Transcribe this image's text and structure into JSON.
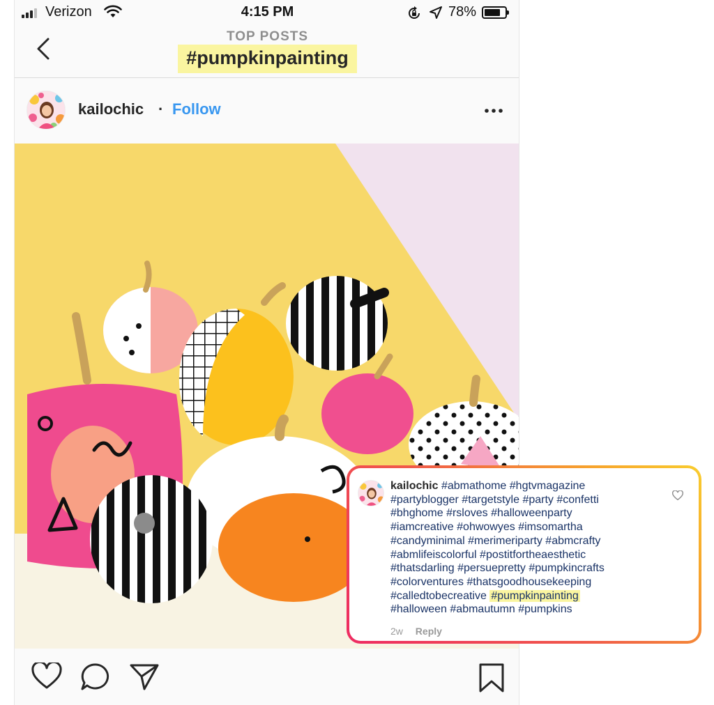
{
  "status_bar": {
    "carrier": "Verizon",
    "time": "4:15 PM",
    "battery_percent": "78%",
    "battery_level": 0.78,
    "icons": [
      "signal-icon",
      "wifi-icon",
      "rotation-lock-icon",
      "location-icon",
      "battery-icon"
    ]
  },
  "header": {
    "kicker": "TOP POSTS",
    "title": "#pumpkinpainting",
    "highlight_color": "#faf5a0",
    "back_icon": "chevron-left-icon"
  },
  "post": {
    "username": "kailochic",
    "separator": "·",
    "follow_label": "Follow",
    "follow_color": "#3897f0",
    "more_icon": "more-horizontal-icon",
    "photo_description_icon": "painted-pumpkins-photo",
    "actions": [
      "heart-icon",
      "comment-icon",
      "share-icon",
      "bookmark-icon"
    ]
  },
  "caption": {
    "username": "kailochic",
    "lines": [
      "#abmathome #hgtvmagazine",
      "#partyblogger #targetstyle #party #confetti",
      "#bhghome #rsloves #halloweenparty",
      "#iamcreative #ohwowyes #imsomartha",
      "#candyminimal #merimeriparty  #abmcrafty",
      "#abmlifeiscolorful #postitfortheaesthetic",
      "#thatsdarling #persuepretty #pumpkincrafts",
      "#colorventures #thatsgoodhousekeeping",
      "#calledtobecreative",
      "#halloween #abmautumn #pumpkins"
    ],
    "highlight_tag": "#pumpkinpainting",
    "age": "2w",
    "reply_label": "Reply",
    "border_gradient": [
      "#ee2a62",
      "#f0594a",
      "#f7a52c",
      "#f9cd2e"
    ],
    "hashtag_color": "#1a3366"
  }
}
